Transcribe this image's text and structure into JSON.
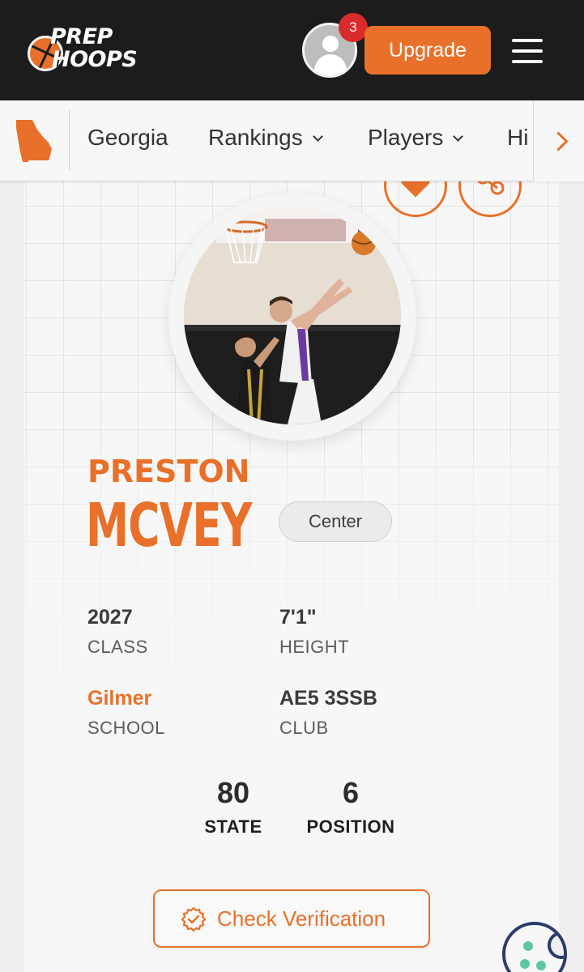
{
  "brand": {
    "logo_line1": "PREP",
    "logo_line2": "HOOPS",
    "accent_color": "#e8702a",
    "header_color": "#1c1c1c"
  },
  "header": {
    "notification_count": "3",
    "upgrade_label": "Upgrade",
    "menu_icon": "hamburger-menu-icon",
    "avatar_icon": "user-avatar-icon"
  },
  "nav": {
    "state_icon": "georgia-state-icon",
    "items": [
      {
        "label": "Georgia"
      },
      {
        "label": "Rankings"
      },
      {
        "label": "Players"
      },
      {
        "label": "Hi"
      }
    ],
    "next_icon": "chevron-right-icon"
  },
  "player": {
    "first_name": "PRESTON",
    "last_name": "MCVEY",
    "position": "Center",
    "stats": {
      "class_value": "2027",
      "class_label": "CLASS",
      "height_value": "7'1\"",
      "height_label": "HEIGHT",
      "school_value": "Gilmer",
      "school_label": "SCHOOL",
      "club_value": "AE5 3SSB",
      "club_label": "CLUB"
    },
    "rankings": {
      "state_value": "80",
      "state_label": "STATE",
      "position_value": "6",
      "position_label": "POSITION"
    }
  },
  "actions": {
    "favorite_icon": "heart-icon",
    "share_icon": "share-icon",
    "verify_label": "Check Verification",
    "verify_icon": "verified-badge-icon",
    "cookie_icon": "cookie-icon"
  }
}
